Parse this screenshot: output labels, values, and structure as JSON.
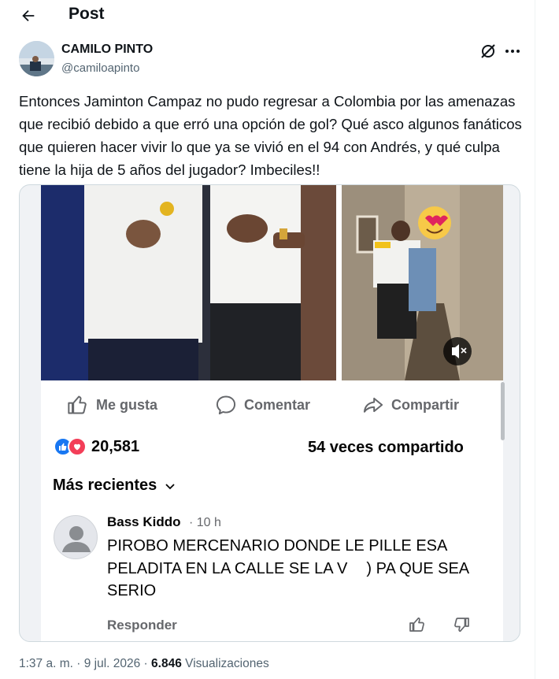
{
  "header": {
    "title": "Post",
    "back_icon": "arrow-left-icon"
  },
  "author": {
    "name": "CAMILO PINTO",
    "handle": "@camiloapinto"
  },
  "tweet": {
    "text": "Entonces Jaminton Campaz no pudo regresar a Colombia por las amenazas que recibió debido a que erró una opción de gol? Qué asco algunos fanáticos que quieren hacer vivir lo que ya se vivió en el 94 con Andrés, y qué culpa tiene la hija de 5 años del jugador? Imbeciles!!"
  },
  "media": {
    "actions": {
      "like": "Me gusta",
      "comment": "Comentar",
      "share": "Compartir"
    },
    "reactions_count": "20,581",
    "shares": "54 veces compartido",
    "sort_label": "Más recientes",
    "comment": {
      "author": "Bass Kiddo",
      "time": "· 10 h",
      "text": "PIROBO MERCENARIO DONDE LE PILLE ESA PELADITA EN LA CALLE SE LA V      ) PA QUE SEA SERIO",
      "reply": "Responder"
    }
  },
  "meta": {
    "time": "1:37 a. m.",
    "sep1": " · ",
    "date": "9 jul. 2026",
    "sep2": " · ",
    "views": "6.846",
    "views_label": " Visualizaciones"
  },
  "colors": {
    "facebook_blue": "#1877f2",
    "love_red": "#f33e58",
    "muted": "#536471"
  }
}
